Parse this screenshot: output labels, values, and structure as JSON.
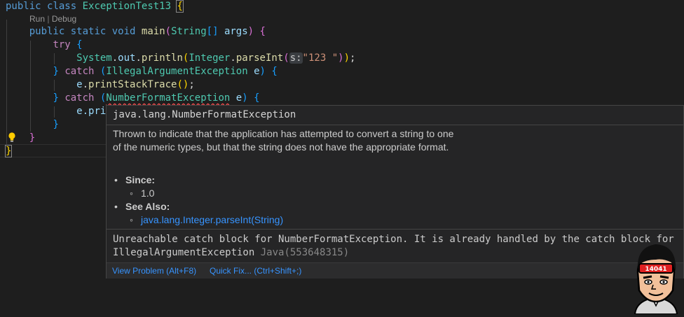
{
  "codelens": {
    "run": "Run",
    "sep": "|",
    "debug": "Debug"
  },
  "code": {
    "l1": {
      "kw1": "public",
      "kw2": "class",
      "cls": "ExceptionTest13",
      "brace": "{"
    },
    "l2": {
      "kw1": "public",
      "kw2": "static",
      "kw3": "void",
      "fn": "main",
      "p1": "(",
      "type": "String",
      "arr": "[]",
      "arg": "args",
      "p2": ")",
      "brace": "{"
    },
    "l3": {
      "kw": "try",
      "brace": "{"
    },
    "l4": {
      "sys": "System",
      "d1": ".",
      "out": "out",
      "d2": ".",
      "println": "println",
      "p1": "(",
      "integer": "Integer",
      "d3": ".",
      "parseInt": "parseInt",
      "p2": "(",
      "hint": "s:",
      "str": "\"123 \"",
      "p3": ")",
      "p4": ")",
      "semi": ";"
    },
    "l5": {
      "brace": "}",
      "kw": "catch",
      "p1": "(",
      "exc": "IllegalArgumentException",
      "var": "e",
      "p2": ")",
      "brace2": "{"
    },
    "l6": {
      "var": "e",
      "dot": ".",
      "fn": "printStackTrace",
      "call": "()",
      "semi": ";"
    },
    "l7": {
      "brace": "}",
      "kw": "catch",
      "p1": "(",
      "exc": "NumberFormatException",
      "var": "e",
      "p2": ")",
      "brace2": "{"
    },
    "l8": {
      "text": "e.pri"
    },
    "l9": {
      "brace": "}"
    },
    "l10": {
      "brace": "}"
    },
    "l11": {
      "brace": "}"
    }
  },
  "hover": {
    "signature": "java.lang.NumberFormatException",
    "description": "Thrown to indicate that the application has attempted to convert a string to one of the numeric types, but that the string does not have the appropriate format.",
    "since_label": "Since:",
    "since_value": "1.0",
    "see_also_label": "See Also:",
    "see_also_link": "java.lang.Integer.parseInt(String)",
    "problem_line1": "Unreachable catch block for NumberFormatException. It is already handled by the catch block for",
    "problem_line2": "IllegalArgumentException",
    "problem_source": "Java(553648315)",
    "view_problem": "View Problem (Alt+F8)",
    "quick_fix": "Quick Fix... (Ctrl+Shift+;)"
  },
  "avatar": {
    "badge": "14041"
  },
  "colors": {
    "background": "#1e1e1e",
    "keyword": "#569cd6",
    "control": "#c586c0",
    "type": "#4ec9b0",
    "function": "#dcdcaa",
    "variable": "#9cdcfe",
    "string": "#ce9178",
    "link": "#3794ff"
  },
  "icons": {
    "lightbulb": "lightbulb-icon"
  }
}
